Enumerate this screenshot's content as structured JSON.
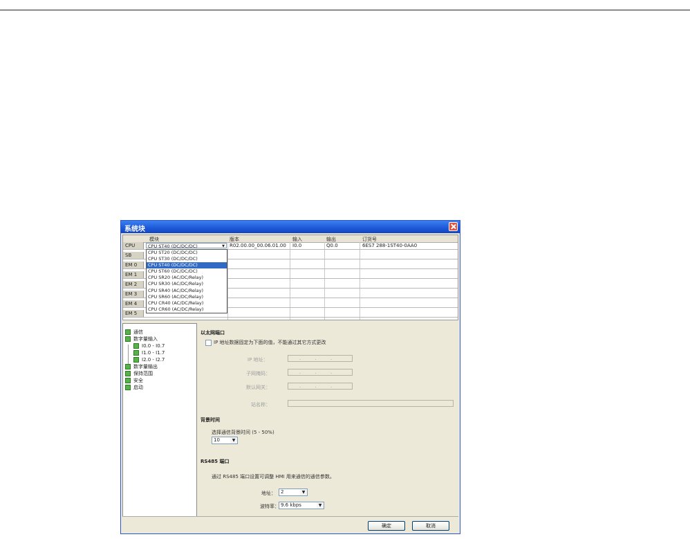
{
  "dialog": {
    "title": "系统块"
  },
  "table": {
    "headers": [
      "模块",
      "版本",
      "输入",
      "输出",
      "订货号"
    ],
    "rows": [
      {
        "label": "CPU",
        "version": "R02.00.00_00.06.01.00",
        "input": "I0.0",
        "output": "Q0.0",
        "order": "6ES7 288-1ST40-0AA0"
      },
      {
        "label": "SB"
      },
      {
        "label": "EM 0"
      },
      {
        "label": "EM 1"
      },
      {
        "label": "EM 2"
      },
      {
        "label": "EM 3"
      },
      {
        "label": "EM 4"
      },
      {
        "label": "EM 5"
      }
    ],
    "module_select_value": "CPU ST40 (DC/DC/DC)",
    "module_options": [
      "CPU ST20 (DC/DC/DC)",
      "CPU ST30 (DC/DC/DC)",
      "CPU ST40 (DC/DC/DC)",
      "CPU ST60 (DC/DC/DC)",
      "CPU SR20 (AC/DC/Relay)",
      "CPU SR30 (AC/DC/Relay)",
      "CPU SR40 (AC/DC/Relay)",
      "CPU SR60 (AC/DC/Relay)",
      "CPU CR40 (AC/DC/Relay)",
      "CPU CR60 (AC/DC/Relay)"
    ],
    "selected_option_index": 2
  },
  "tree": {
    "items": [
      "通信",
      "数字量输入",
      "I0.0 - I0.7",
      "I1.0 - I1.7",
      "I2.0 - I2.7",
      "数字量输出",
      "保持范围",
      "安全",
      "启动"
    ]
  },
  "ethernet": {
    "heading": "以太网端口",
    "fixed_ip_label": "IP 地址数据固定为下面的值，不能通过其它方式更改",
    "ip_label": "IP 地址：",
    "subnet_label": "子网掩码：",
    "gateway_label": "默认网关：",
    "station_label": "站名称："
  },
  "background": {
    "heading": "背景时间",
    "select_label": "选择通信背景时间 (5 - 50%)",
    "value": "10"
  },
  "rs485": {
    "heading": "RS485 端口",
    "description": "通过 RS485 端口设置可调整 HMI 用来通信的通信参数。",
    "address_label": "地址：",
    "address_value": "2",
    "baud_label": "波特率：",
    "baud_value": "9.6 kbps"
  },
  "buttons": {
    "ok": "确定",
    "cancel": "取消"
  },
  "colors": {
    "titlebar": "#1d58d8",
    "dialog_bg": "#ece9d8",
    "selection": "#316ac5"
  }
}
